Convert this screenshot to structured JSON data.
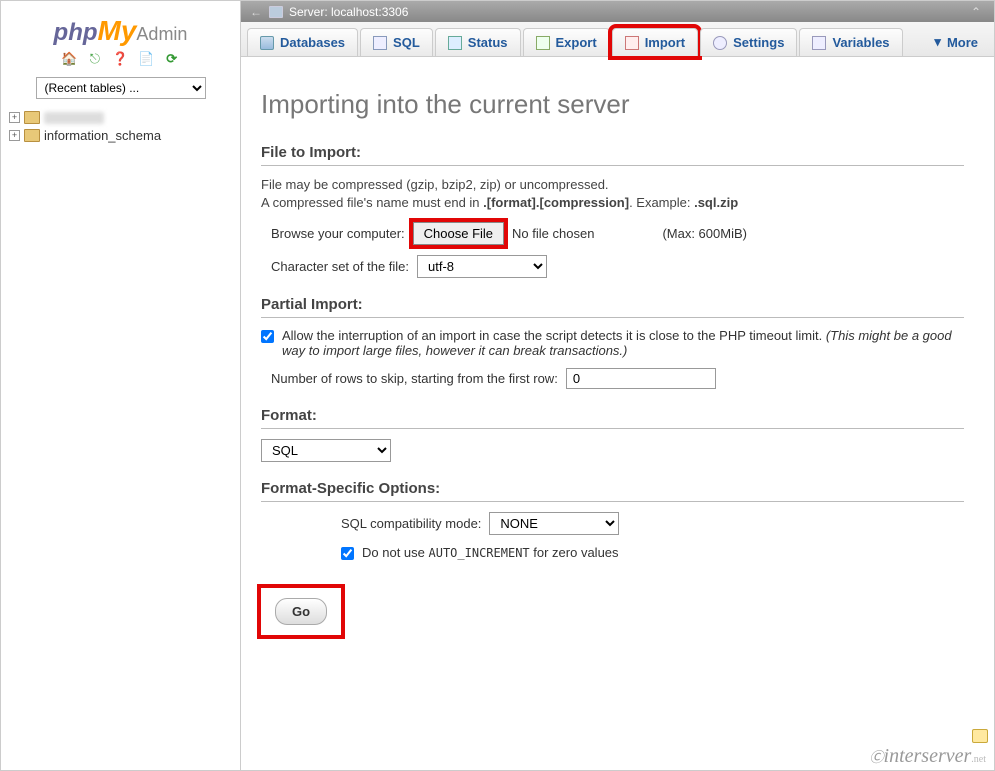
{
  "logo": {
    "part1": "php",
    "part2": "My",
    "part3": "Admin"
  },
  "sidebar": {
    "recent_placeholder": "(Recent tables) ...",
    "items": [
      {
        "label": ""
      },
      {
        "label": "information_schema"
      }
    ]
  },
  "server_bar": {
    "label": "Server: localhost:3306"
  },
  "tabs": {
    "databases": "Databases",
    "sql": "SQL",
    "status": "Status",
    "export": "Export",
    "import": "Import",
    "settings": "Settings",
    "variables": "Variables",
    "more": "More"
  },
  "page_title": "Importing into the current server",
  "file_to_import": {
    "title": "File to Import:",
    "hint_line1": "File may be compressed (gzip, bzip2, zip) or uncompressed.",
    "hint_line2a": "A compressed file's name must end in ",
    "hint_bold": ".[format].[compression]",
    "hint_line2b": ". Example: ",
    "hint_example": ".sql.zip",
    "browse_label": "Browse your computer:",
    "choose_file_btn": "Choose File",
    "no_file": "No file chosen",
    "max_size": "(Max: 600MiB)",
    "charset_label": "Character set of the file:",
    "charset_value": "utf-8"
  },
  "partial_import": {
    "title": "Partial Import:",
    "allow_label_a": "Allow the interruption of an import in case the script detects it is close to the PHP timeout limit. ",
    "allow_label_em": "(This might be a good way to import large files, however it can break transactions.)",
    "rows_skip_label": "Number of rows to skip, starting from the first row:",
    "rows_skip_value": "0"
  },
  "format": {
    "title": "Format:",
    "value": "SQL"
  },
  "format_specific": {
    "title": "Format-Specific Options:",
    "compat_label": "SQL compatibility mode:",
    "compat_value": "NONE",
    "noauto_a": "Do not use ",
    "noauto_code": "AUTO_INCREMENT",
    "noauto_b": " for zero values"
  },
  "go_button": "Go",
  "watermark": "interserver"
}
